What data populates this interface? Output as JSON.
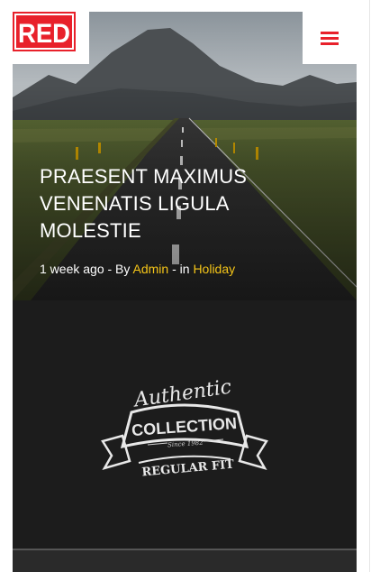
{
  "header": {
    "logo_text": "RED",
    "menu_icon": "hamburger-menu-icon",
    "accent_color": "#e8212b"
  },
  "posts": [
    {
      "title": "PRAESENT MAXIMUS VENENATIS LIGULA MOLESTIE",
      "meta": {
        "time": "1 week ago",
        "by_sep": " - By ",
        "author": "Admin",
        "in_sep": " - in ",
        "category": "Holiday"
      },
      "link_color": "#f5c518"
    },
    {
      "badge": {
        "line1": "Authentic",
        "line2": "COLLECTION",
        "line3": "Since 1982",
        "line4": "REGULAR FIT"
      }
    }
  ]
}
